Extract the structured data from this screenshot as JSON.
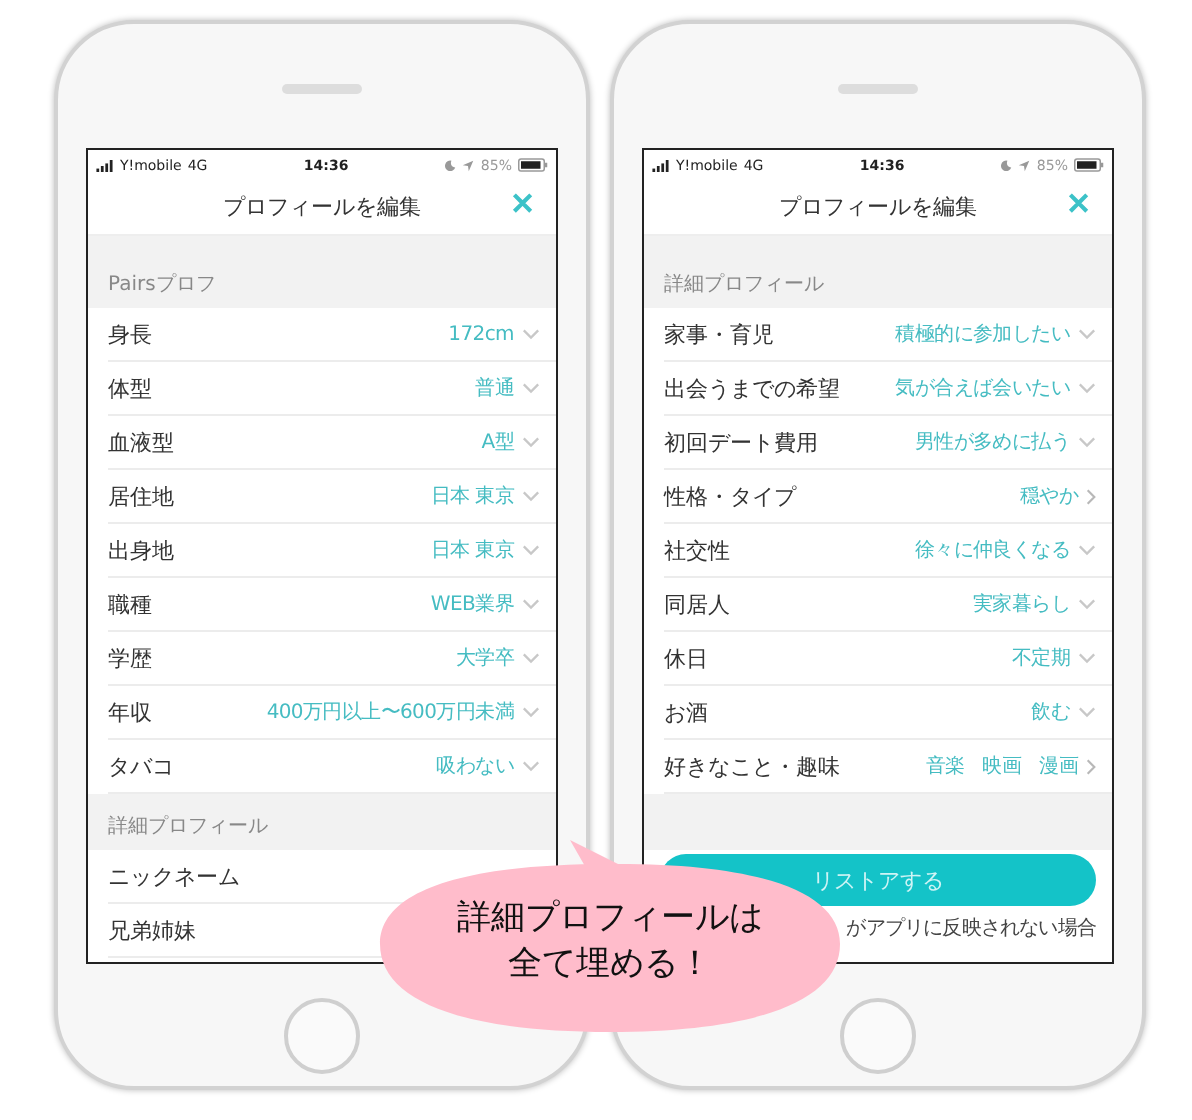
{
  "phones": [
    {
      "status_bar": {
        "carrier": "Y!mobile",
        "network": "4G",
        "time": "14:36",
        "battery": "85%"
      },
      "header": {
        "title": "プロフィールを編集",
        "close": "✕"
      },
      "sections": [
        {
          "title": "Pairsプロフ",
          "rows": [
            {
              "label": "身長",
              "value": "172cm",
              "kind": "select"
            },
            {
              "label": "体型",
              "value": "普通",
              "kind": "select"
            },
            {
              "label": "血液型",
              "value": "A型",
              "kind": "select"
            },
            {
              "label": "居住地",
              "value": "日本 東京",
              "kind": "select"
            },
            {
              "label": "出身地",
              "value": "日本 東京",
              "kind": "select"
            },
            {
              "label": "職種",
              "value": "WEB業界",
              "kind": "select"
            },
            {
              "label": "学歴",
              "value": "大学卒",
              "kind": "select"
            },
            {
              "label": "年収",
              "value": "400万円以上〜600万円未満",
              "kind": "select"
            },
            {
              "label": "タバコ",
              "value": "吸わない",
              "kind": "select"
            }
          ]
        },
        {
          "title": "詳細プロフィール",
          "rows": [
            {
              "label": "ニックネーム",
              "kind": "link"
            },
            {
              "label": "兄弟姉妹",
              "kind": "plain"
            }
          ]
        }
      ]
    },
    {
      "status_bar": {
        "carrier": "Y!mobile",
        "network": "4G",
        "time": "14:36",
        "battery": "85%"
      },
      "header": {
        "title": "プロフィールを編集",
        "close": "✕"
      },
      "sections": [
        {
          "title": "詳細プロフィール",
          "rows": [
            {
              "label": "家事・育児",
              "value": "積極的に参加したい",
              "kind": "select"
            },
            {
              "label": "出会うまでの希望",
              "value": "気が合えば会いたい",
              "kind": "select"
            },
            {
              "label": "初回デート費用",
              "value": "男性が多めに払う",
              "kind": "select"
            },
            {
              "label": "性格・タイプ",
              "value": "穏やか",
              "kind": "link"
            },
            {
              "label": "社交性",
              "value": "徐々に仲良くなる",
              "kind": "select"
            },
            {
              "label": "同居人",
              "value": "実家暮らし",
              "kind": "select"
            },
            {
              "label": "休日",
              "value": "不定期",
              "kind": "select"
            },
            {
              "label": "お酒",
              "value": "飲む",
              "kind": "select"
            },
            {
              "label": "好きなこと・趣味",
              "tags": [
                "音楽",
                "映画",
                "漫画"
              ],
              "kind": "link"
            }
          ]
        }
      ],
      "button": "リストアする",
      "note": "がアプリに反映されない場合"
    }
  ],
  "callout": [
    "詳細プロフィールは",
    "全て埋める！"
  ]
}
